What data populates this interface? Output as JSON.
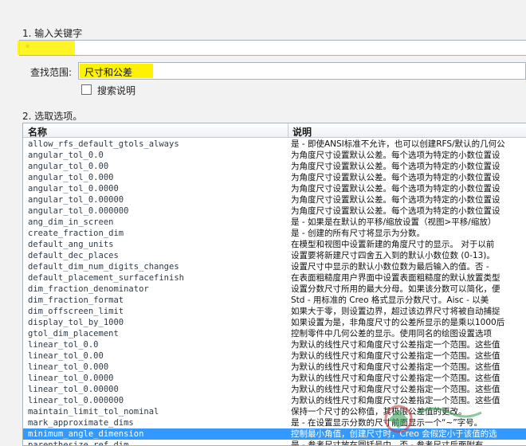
{
  "step1": {
    "label": "1.  输入关键字"
  },
  "keyword": {
    "value": "*"
  },
  "scope": {
    "label": "查找范围:",
    "value": "尺寸和公差"
  },
  "search_description": {
    "label": "搜索说明",
    "checked": false
  },
  "step2": {
    "label": "2.  选取选项。"
  },
  "table": {
    "columns": {
      "name": "名称",
      "description": "说明"
    },
    "rows": [
      {
        "name": "allow_rfs_default_gtols_always",
        "desc": "是 - 即使ANSI标准不允许，也可以创建RFS/默认的几何公"
      },
      {
        "name": "angular_tol_0.0",
        "desc": "为角度尺寸设置默认公差。每个选项为特定的小数位置设"
      },
      {
        "name": "angular_tol_0.00",
        "desc": "为角度尺寸设置默认公差。每个选项为特定的小数位置设"
      },
      {
        "name": "angular_tol_0.000",
        "desc": "为角度尺寸设置默认公差。每个选项为特定的小数位置设"
      },
      {
        "name": "angular_tol_0.0000",
        "desc": "为角度尺寸设置默认公差。每个选项为特定的小数位置设"
      },
      {
        "name": "angular_tol_0.00000",
        "desc": "为角度尺寸设置默认公差。每个选项为特定的小数位置设"
      },
      {
        "name": "angular_tol_0.000000",
        "desc": "为角度尺寸设置默认公差。每个选项为特定的小数位置设"
      },
      {
        "name": "ang_dim_in_screen",
        "desc": "是 - 如果是在默认的平移/缩放设置（视图>平移/缩放）"
      },
      {
        "name": "create_fraction_dim",
        "desc": "是 - 创建的所有尺寸将显示为分数。"
      },
      {
        "name": "default_ang_units",
        "desc": "在模型和视图中设置新建的角度尺寸的显示。 对于以前"
      },
      {
        "name": "default_dec_places",
        "desc": "设置要将新建尺寸四舍五入到的默认小数位数 (0-13)。"
      },
      {
        "name": "default_dim_num_digits_changes",
        "desc": "设置尺寸中显示的默认小数位数为最后输入的值。否 -"
      },
      {
        "name": "default_placement_surfacefinish",
        "desc": "在表面粗糙度用户界面中设置表面粗糙度的默认放置类型"
      },
      {
        "name": "dim_fraction_denominator",
        "desc": "设置分数尺寸所用的最大分母。如果该分数可以简化，便"
      },
      {
        "name": "dim_fraction_format",
        "desc": "Std - 用标准的 Creo 格式显示分数尺寸。Aisc - 以美"
      },
      {
        "name": "dim_offscreen_limit",
        "desc": "如果大于零，则设置边界，超过该边界尺寸将被自动捕捉"
      },
      {
        "name": "display_tol_by_1000",
        "desc": "如果设置为是，非角度尺寸的公差所显示的是乘以1000后"
      },
      {
        "name": "gtol_dim_placement",
        "desc": "控制零件中几何公差的显示。使用同名的绘图设置选项"
      },
      {
        "name": "linear_tol_0.0",
        "desc": "为默认的线性尺寸和角度尺寸公差指定一个范围。这些值"
      },
      {
        "name": "linear_tol_0.00",
        "desc": "为默认的线性尺寸和角度尺寸公差指定一个范围。这些值"
      },
      {
        "name": "linear_tol_0.000",
        "desc": "为默认的线性尺寸和角度尺寸公差指定一个范围。这些值"
      },
      {
        "name": "linear_tol_0.0000",
        "desc": "为默认的线性尺寸和角度尺寸公差指定一个范围。这些值"
      },
      {
        "name": "linear_tol_0.00000",
        "desc": "为默认的线性尺寸和角度尺寸公差指定一个范围。这些值"
      },
      {
        "name": "linear_tol_0.000000",
        "desc": "为默认的线性尺寸和角度尺寸公差指定一个范围。这些值"
      },
      {
        "name": "maintain_limit_tol_nominal",
        "desc": "保持一个尺寸的公称值，其极限公差值的更改。"
      },
      {
        "name": "mark_approximate_dims",
        "desc": "是 - 在设置显示分数的尺寸前面显示一个“~”字号。"
      },
      {
        "name": "minimum_angle_dimension",
        "desc": "控制最小角值，创建尺寸时，Creo 会假定小于该值的选"
      },
      {
        "name": "parenthesize_ref_dim",
        "desc": "是 - 参考尺寸放在圆括号中。否 - 参考尺寸后面附有"
      }
    ],
    "selected_index": 26
  },
  "colors": {
    "highlight": "#fff200",
    "selection": "#3399ff"
  }
}
